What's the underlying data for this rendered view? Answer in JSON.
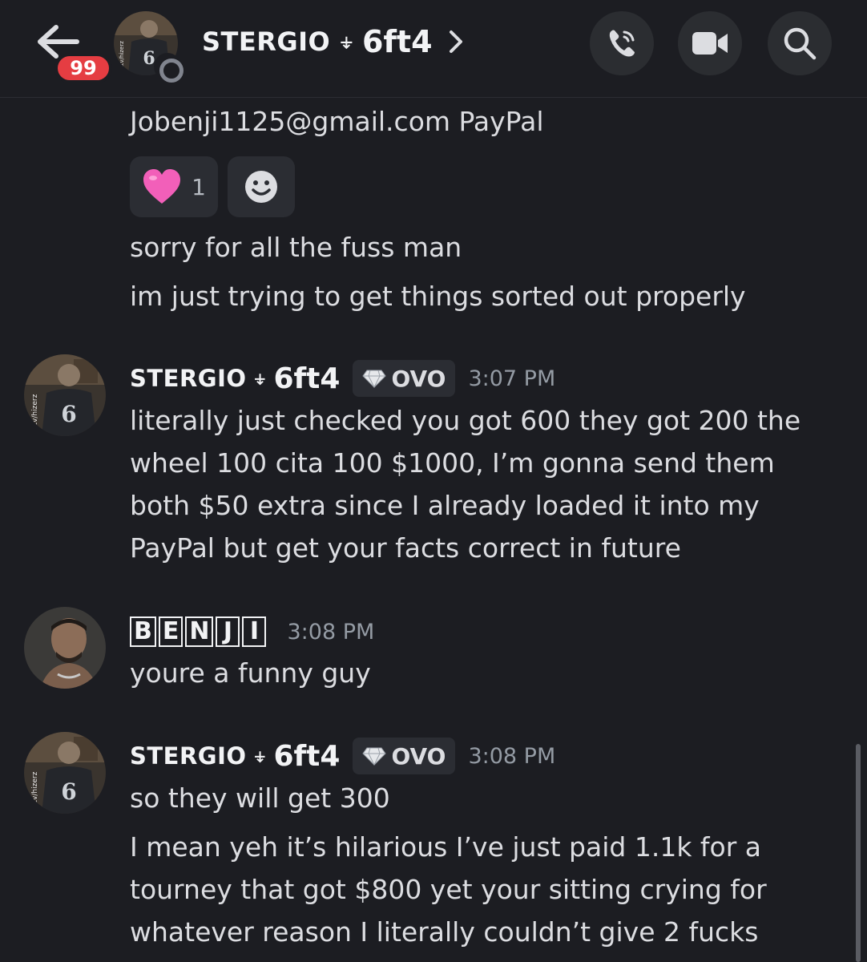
{
  "header": {
    "unread_count": "99",
    "title_name": "STERGIO",
    "title_separator": "⍖",
    "title_tag": "6ft4",
    "avatar_text": "ttv/hizerz",
    "jersey_number": "6"
  },
  "messages": [
    {
      "kind": "continuation",
      "lines": [
        "Jobenji1125@gmail.com PayPal"
      ]
    },
    {
      "kind": "reactions",
      "reactions": [
        {
          "emoji": "pink-heart",
          "count": "1"
        },
        {
          "emoji": "add-reaction-smile"
        }
      ]
    },
    {
      "kind": "continuation",
      "lines": [
        "sorry for all the fuss man"
      ]
    },
    {
      "kind": "continuation",
      "lines": [
        "im just trying to get things sorted out properly"
      ]
    },
    {
      "kind": "message",
      "author": "STERGIO",
      "author_tag": "6ft4",
      "clan_tag": "OVO",
      "timestamp": "3:07 PM",
      "lines": [
        "literally just checked  you got 600 they got 200 the",
        "wheel 100 cita 100   $1000,  I’m gonna send them",
        "both $50 extra since I already loaded it into my",
        "PayPal but get your facts correct in future"
      ]
    },
    {
      "kind": "message",
      "author_letters": [
        "B",
        "E",
        "N",
        "J",
        "I"
      ],
      "timestamp": "3:08 PM",
      "lines": [
        "youre a funny guy"
      ]
    },
    {
      "kind": "message",
      "author": "STERGIO",
      "author_tag": "6ft4",
      "clan_tag": "OVO",
      "timestamp": "3:08 PM",
      "lines": [
        "so they will get 300"
      ]
    },
    {
      "kind": "continuation",
      "lines": [
        "I mean yeh it’s hilarious I’ve just paid 1.1k for a",
        "tourney that got $800 yet your sitting crying for",
        "whatever reason  I literally couldn’t give 2 fucks"
      ]
    }
  ],
  "colors": {
    "background": "#1c1d22",
    "badge": "#e53d42",
    "text": "#dcdde1",
    "muted": "#949ba4"
  }
}
